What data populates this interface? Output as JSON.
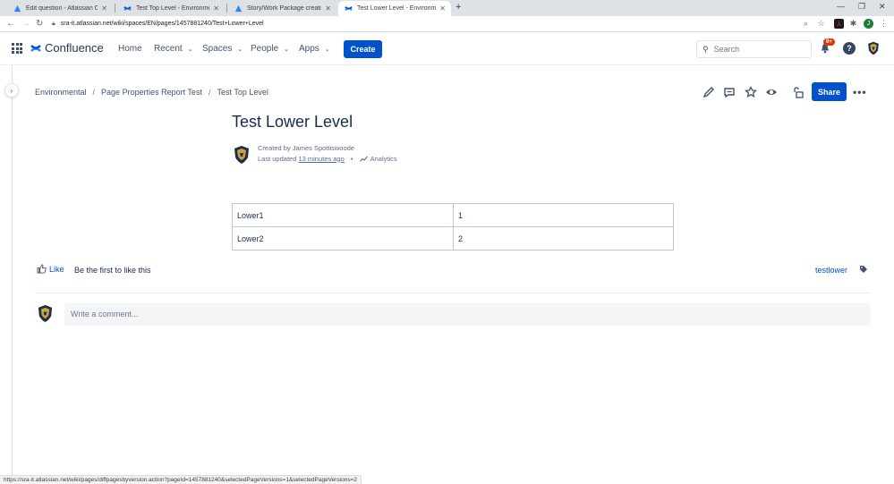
{
  "browser": {
    "tabs": [
      {
        "title": "Edit question - Atlassian Commu",
        "active": false
      },
      {
        "title": "Test Top Level - Environmental -",
        "active": false
      },
      {
        "title": "Story/Work Package creation, ex",
        "active": false
      },
      {
        "title": "Test Lower Level - Environmenta",
        "active": true
      }
    ],
    "new_tab": "+",
    "url": "sra-it.atlassian.net/wiki/spaces/EN/pages/1457881240/Test+Lower+Level",
    "profile_initial": "J"
  },
  "header": {
    "product": "Confluence",
    "nav": {
      "home": "Home",
      "recent": "Recent",
      "spaces": "Spaces",
      "people": "People",
      "apps": "Apps"
    },
    "create": "Create",
    "search_placeholder": "Search",
    "notification_badge": "9+",
    "help": "?"
  },
  "breadcrumb": {
    "items": [
      "Environmental",
      "Page Properties Report Test",
      "Test Top Level"
    ],
    "separator": "/"
  },
  "actions": {
    "share": "Share"
  },
  "page": {
    "title": "Test Lower Level",
    "created_by": "Created by James Spottiswoode",
    "last_updated_label": "Last updated",
    "last_updated_time": "13 minutes ago",
    "analytics": "Analytics",
    "table": [
      {
        "key": "Lower1",
        "value": "1"
      },
      {
        "key": "Lower2",
        "value": "2"
      }
    ]
  },
  "footer": {
    "like": "Like",
    "first_like": "Be the first to like this",
    "label": "testlower",
    "comment_placeholder": "Write a comment..."
  },
  "statusbar": {
    "url": "https://sra-it.atlassian.net/wiki/pages/diffpagesbyversion.action?pageId=1457881240&selectedPageVersions=1&selectedPageVersions=2"
  },
  "colors": {
    "brand": "#0052cc",
    "text": "#172b4d",
    "badge": "#de350b"
  }
}
